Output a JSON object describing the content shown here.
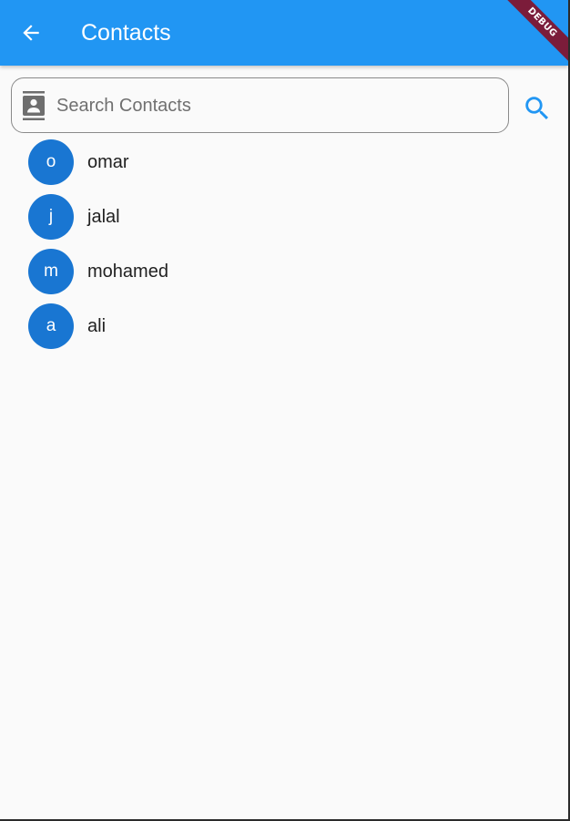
{
  "appbar": {
    "title": "Contacts",
    "back_icon": "arrow-back-icon",
    "color": "#2196f3"
  },
  "debug_banner": {
    "label": "DEBUG",
    "color": "#7b1c3a"
  },
  "search": {
    "placeholder": "Search Contacts",
    "value": "",
    "prefix_icon": "contact-book-icon",
    "button_icon": "search-icon",
    "button_color": "#2196f3"
  },
  "contacts": [
    {
      "initial": "o",
      "name": "omar"
    },
    {
      "initial": "j",
      "name": "jalal"
    },
    {
      "initial": "m",
      "name": "mohamed"
    },
    {
      "initial": "a",
      "name": "ali"
    }
  ],
  "avatar_color": "#1976d2"
}
